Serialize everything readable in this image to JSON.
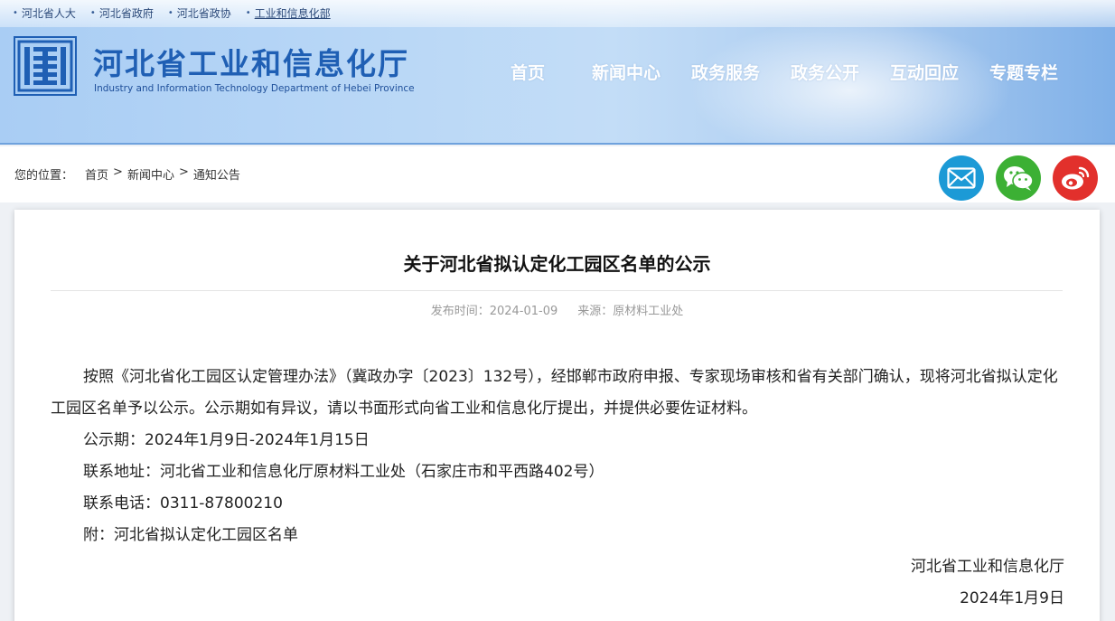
{
  "top_links": [
    "河北省人大",
    "河北省政府",
    "河北省政协",
    "工业和信息化部"
  ],
  "site": {
    "title": "河北省工业和信息化厅",
    "subtitle": "Industry and Information Technology Department of Hebei Province"
  },
  "nav": [
    "首页",
    "新闻中心",
    "政务服务",
    "政务公开",
    "互动回应",
    "专题专栏"
  ],
  "breadcrumb": {
    "prefix": "您的位置：",
    "items": [
      "首页",
      "新闻中心",
      "通知公告"
    ],
    "separator": ">"
  },
  "share_icons": {
    "mail": "mail-icon",
    "wechat": "wechat-icon",
    "weibo": "weibo-icon",
    "colors": {
      "mail": "#1c9ad6",
      "wechat": "#3cb034",
      "weibo": "#e2302c"
    }
  },
  "article": {
    "title": "关于河北省拟认定化工园区名单的公示",
    "publish_label": "发布时间：",
    "publish_date": "2024-01-09",
    "source_label": "来源：",
    "source": "原材料工业处",
    "paragraphs": [
      "按照《河北省化工园区认定管理办法》（冀政办字〔2023〕132号），经邯郸市政府申报、专家现场审核和省有关部门确认，现将河北省拟认定化工园区名单予以公示。公示期如有异议，请以书面形式向省工业和信息化厅提出，并提供必要佐证材料。",
      "公示期：2024年1月9日-2024年1月15日",
      "联系地址：河北省工业和信息化厅原材料工业处（石家庄市和平西路402号）",
      "联系电话：0311-87800210",
      "附：河北省拟认定化工园区名单"
    ],
    "signature": "河北省工业和信息化厅",
    "sign_date": "2024年1月9日"
  }
}
